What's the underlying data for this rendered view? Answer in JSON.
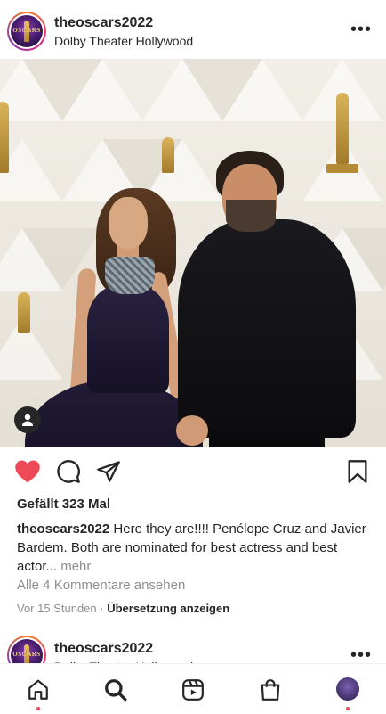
{
  "post": {
    "username": "theoscars2022",
    "location": "Dolby Theater Hollywood",
    "avatar_text": "OSCARS",
    "likes": "Gefällt 323 Mal",
    "caption_user": "theoscars2022",
    "caption_text": " Here they are!!!! Penélope Cruz and Javier Bardem. Both are nominated for best actress and best actor",
    "caption_ellipsis": "... ",
    "caption_more": "mehr",
    "comments_link": "Alle 4 Kommentare ansehen",
    "time": "Vor 15 Stunden",
    "separator": " · ",
    "translate": "Übersetzung anzeigen",
    "liked": true,
    "like_color": "#ed4956"
  },
  "next_post": {
    "username": "theoscars2022",
    "location": "Dolby Theater Hollywood",
    "avatar_text": "OSCARS"
  },
  "icons": {
    "more": "more-options-icon",
    "like": "heart-icon",
    "comment": "comment-icon",
    "share": "send-icon",
    "save": "bookmark-icon",
    "tag": "user-tag-icon",
    "nav": [
      "home-icon",
      "search-icon",
      "reels-icon",
      "shop-icon",
      "profile-avatar"
    ]
  },
  "nav_dot_color": "#ed4956"
}
